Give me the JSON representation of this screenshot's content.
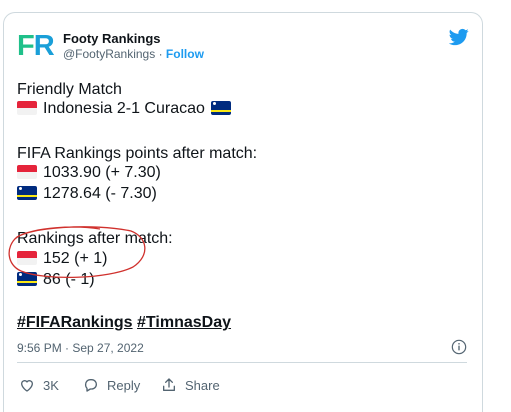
{
  "author": {
    "logo_f": "F",
    "logo_r": "R",
    "name": "Footy Rankings",
    "handle": "@FootyRankings",
    "separator": " · ",
    "follow": "Follow"
  },
  "tweet": {
    "line1": "Friendly Match",
    "match_teams": "Indonesia 2-1 Curacao",
    "points_heading": "FIFA Rankings points after match:",
    "indonesia_points": "1033.90 (+ 7.30)",
    "curacao_points": "1278.64 (- 7.30)",
    "rank_heading": "Rankings after match:",
    "indonesia_rank": "152 (+ 1)",
    "curacao_rank": "86 (- 1)",
    "hashtag1": "#FIFARankings",
    "hashtag2": "#TimnasDay",
    "timestamp": "9:56 PM · Sep 27, 2022"
  },
  "actions": {
    "likes": "3K",
    "reply": "Reply",
    "share": "Share"
  },
  "colors": {
    "accent": "#1d9bf0",
    "circle_annotation": "#d0312d",
    "indonesia_red": "#e5243b",
    "curacao_blue": "#002b7f"
  },
  "icons": [
    "twitter-bird-icon",
    "info-icon",
    "heart-icon",
    "reply-icon",
    "share-icon",
    "indonesia-flag-icon",
    "curacao-flag-icon"
  ]
}
